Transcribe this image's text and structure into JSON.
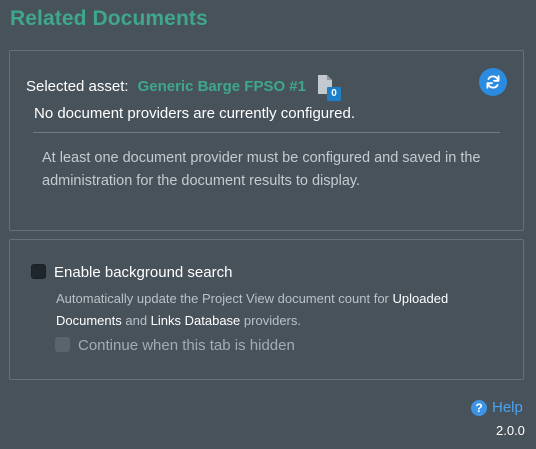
{
  "header": {
    "title": "Related Documents"
  },
  "documents": {
    "selected_asset_label": "Selected asset:",
    "selected_asset_name": "Generic Barge FPSO #1",
    "document_count": "0",
    "status_message": "No document providers are currently configured.",
    "provider_note": "At least one document provider must be configured and saved in the administration for the document results to display.",
    "refresh_icon": "refresh-icon",
    "document_icon": "document-icon"
  },
  "background_search": {
    "enable_label": "Enable background search",
    "enable_checked": false,
    "description_part1": "Automatically update the Project View document count for ",
    "description_em1": "Uploaded Documents",
    "description_part2": " and ",
    "description_em2": "Links Database",
    "description_part3": " providers.",
    "continue_label": "Continue when this tab is hidden",
    "continue_checked": false,
    "continue_disabled": true
  },
  "footer": {
    "help_label": "Help",
    "help_icon": "question-circle-icon",
    "version": "2.0.0"
  },
  "colors": {
    "background": "#48525b",
    "accent_green": "#3ea78c",
    "accent_blue": "#2a8be0",
    "link_blue": "#4aa3f0"
  }
}
